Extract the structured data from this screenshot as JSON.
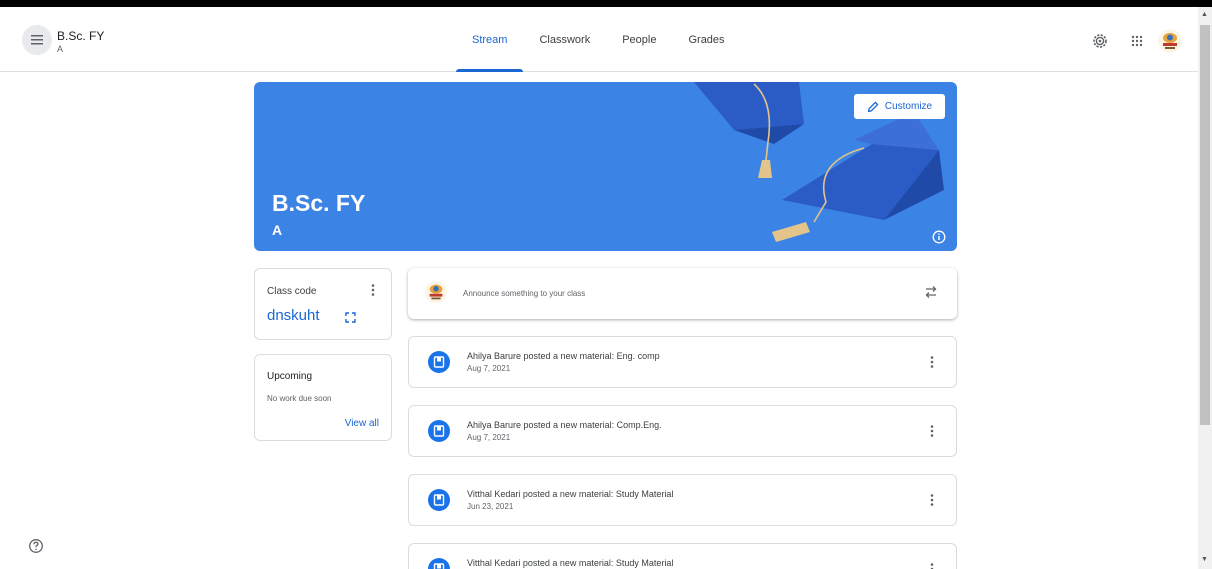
{
  "header": {
    "class_title": "B.Sc. FY",
    "class_section": "A",
    "tabs": [
      {
        "label": "Stream",
        "active": true
      },
      {
        "label": "Classwork",
        "active": false
      },
      {
        "label": "People",
        "active": false
      },
      {
        "label": "Grades",
        "active": false
      }
    ],
    "icons": [
      "settings-icon",
      "apps-grid-icon",
      "user-avatar"
    ]
  },
  "banner": {
    "title": "B.Sc. FY",
    "section": "A",
    "customize_label": "Customize",
    "color": "#3b83e5"
  },
  "class_code": {
    "label": "Class code",
    "value": "dnskuht"
  },
  "upcoming": {
    "title": "Upcoming",
    "message": "No work due soon",
    "link_label": "View all"
  },
  "announce": {
    "placeholder": "Announce something to your class"
  },
  "posts": [
    {
      "title": "Ahilya Barure posted a new material: Eng. comp",
      "date": "Aug 7, 2021"
    },
    {
      "title": "Ahilya Barure posted a new material: Comp.Eng.",
      "date": "Aug 7, 2021"
    },
    {
      "title": "Vitthal Kedari posted a new material: Study Material",
      "date": "Jun 23, 2021"
    },
    {
      "title": "Vitthal Kedari posted a new material: Study Material",
      "date": ""
    }
  ],
  "colors": {
    "accent": "#1967d2",
    "post_icon": "#1a73e8"
  }
}
